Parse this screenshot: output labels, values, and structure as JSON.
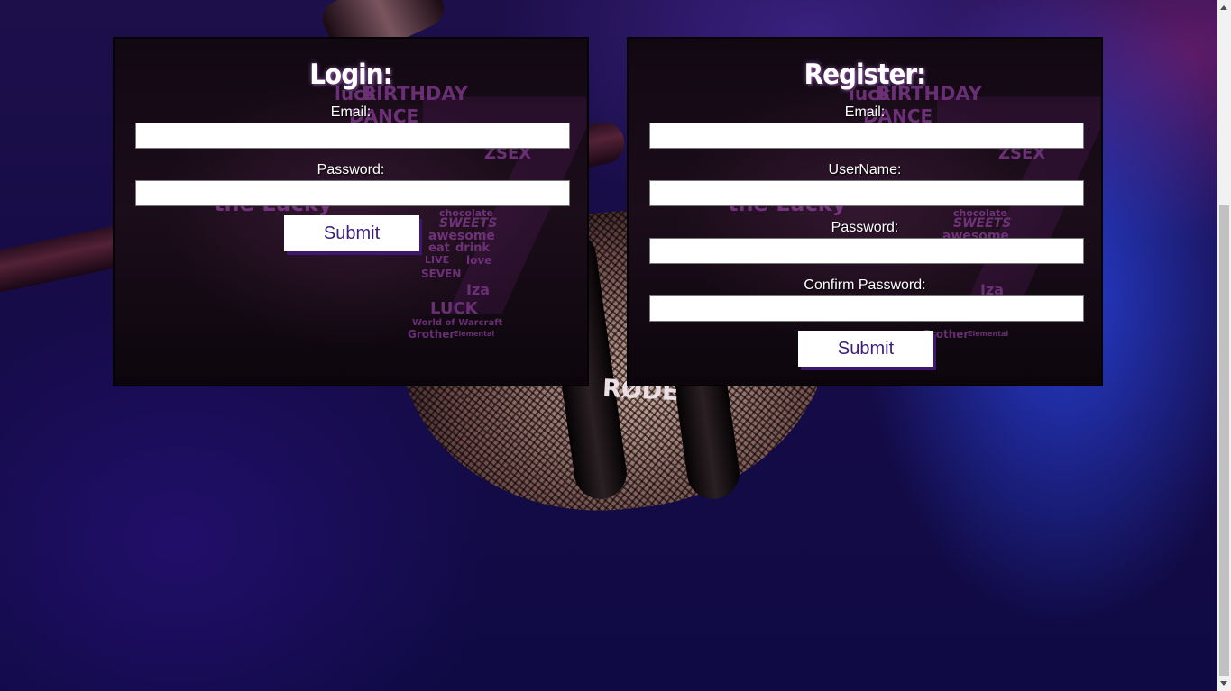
{
  "login": {
    "title": "Login:",
    "email_label": "Email:",
    "password_label": "Password:",
    "submit_label": "Submit"
  },
  "register": {
    "title": "Register:",
    "email_label": "Email:",
    "username_label": "UserName:",
    "password_label": "Password:",
    "confirm_password_label": "Confirm Password:",
    "submit_label": "Submit"
  },
  "background": {
    "mic_brand": "RØDE",
    "artwork_words": [
      "BIRTHDAY",
      "luck",
      "DANCE",
      "ZSEX",
      "the Lucky",
      "chocolate",
      "SWEETS",
      "awesome",
      "eat",
      "drink",
      "LIVE",
      "love",
      "SEVEN",
      "Iza",
      "LUCK",
      "World of Warcraft",
      "Grother",
      "Elemental"
    ]
  },
  "colors": {
    "accent": "#3b1e78",
    "panel_bg": "#150a15",
    "text": "#ffffff"
  }
}
